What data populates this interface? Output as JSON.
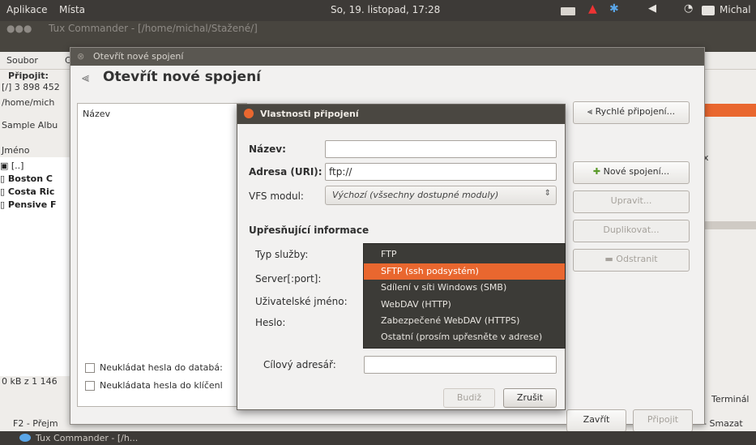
{
  "panel": {
    "menu1": "Aplikace",
    "menu2": "Místa",
    "clock": "So, 19. listopad, 17:28",
    "user": "Michal"
  },
  "bg": {
    "title": "Tux Commander - [/home/michal/Stažené/]",
    "menu_file": "Soubor",
    "menu_more": "C",
    "connect_label": "Připojit:",
    "disk_info": "[/] 3 898 452",
    "path": "/home/mich",
    "bookmark": "Sample Albu",
    "col_name": "Jméno",
    "files": [
      "[..]",
      "Boston C",
      "Costa Ric",
      "Pensive F"
    ],
    "status": "0 kB z 1 146",
    "f2": "F2 - Přejm",
    "right_x": "x",
    "right_tab": "Terminál",
    "right_del": "- Smazat",
    "taskbar_item": "Tux Commander - [/h..."
  },
  "open_dialog": {
    "window_title": "Otevřít nové spojení",
    "heading": "Otevřít nové spojení",
    "list_header": "Název",
    "chk_db": "Neukládat hesla do databá:",
    "chk_keyring": "Neukládata hesla do klíčenl",
    "btn_quick": "Rychlé připojení...",
    "btn_new": "Nové spojení...",
    "btn_edit": "Upravit...",
    "btn_dup": "Duplikovat...",
    "btn_remove": "Odstranit",
    "btn_close": "Zavřít",
    "btn_connect": "Připojit"
  },
  "props_dialog": {
    "title": "Vlastnosti připojení",
    "name_label": "Název:",
    "name_value": "",
    "uri_label": "Adresa (URI):",
    "uri_value": "ftp://",
    "vfs_label": "VFS modul:",
    "vfs_value": "Výchozí (všsechny dostupné moduly)",
    "section": "Upřesňující informace",
    "service_label": "Typ služby:",
    "server_label": "Server[:port]:",
    "user_label": "Uživatelské jméno:",
    "pass_label": "Heslo:",
    "target_label": "Cílový adresář:",
    "target_value": "",
    "btn_ok": "Budiž",
    "btn_cancel": "Zrušit"
  },
  "service_menu": {
    "items": [
      "FTP",
      "SFTP (ssh podsystém)",
      "Sdílení v síti Windows (SMB)",
      "WebDAV (HTTP)",
      "Zabezpečené WebDAV (HTTPS)",
      "Ostatní (prosím upřesněte v adrese)"
    ],
    "selected_index": 1
  },
  "colors": {
    "accent": "#e9672f",
    "panel": "#3d3a37"
  }
}
